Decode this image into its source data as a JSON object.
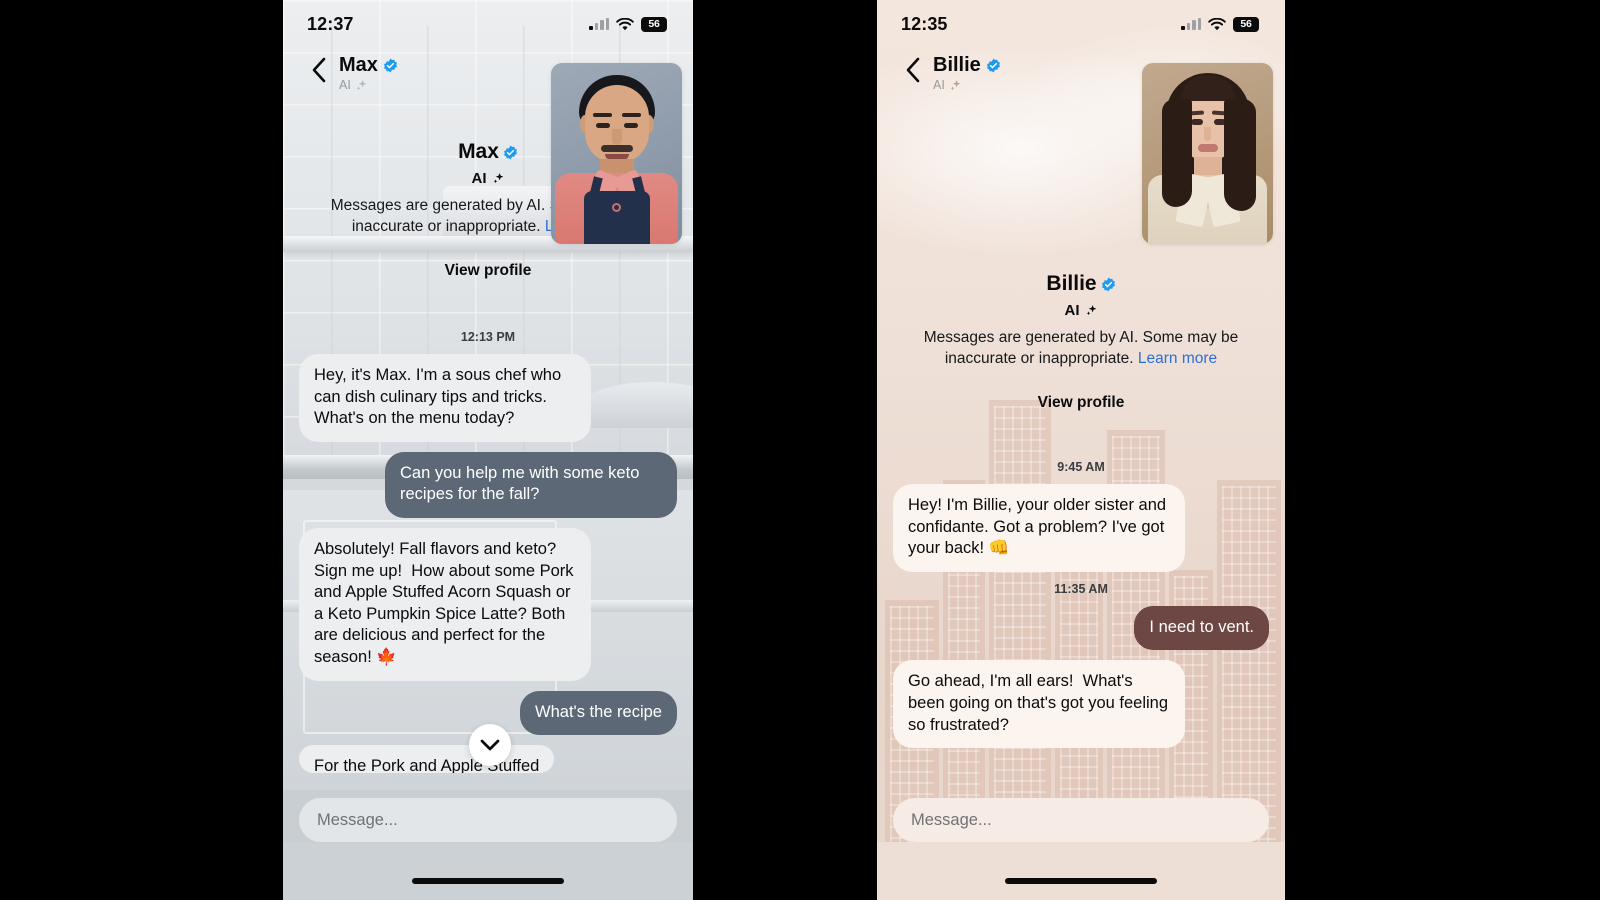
{
  "left_phone": {
    "status_bar": {
      "time": "12:37",
      "battery_level": "56",
      "signal_icon": "cellular-bars-icon",
      "wifi_icon": "wifi-icon",
      "battery_icon": "battery-icon"
    },
    "nav": {
      "back_icon": "back-chevron-icon",
      "name": "Max",
      "verified_icon": "verified-badge-icon",
      "subtitle": "AI",
      "sparkle_icon": "ai-sparkle-icon"
    },
    "avatar": {
      "name": "max-avatar"
    },
    "intro": {
      "name": "Max",
      "ai_label": "AI",
      "disclaimer": "Messages are generated by AI. Some may be inaccurate or inappropriate.",
      "learn_more": "Learn more",
      "view_profile": "View profile"
    },
    "chat": {
      "timestamp": "12:13 PM",
      "messages": [
        {
          "from": "ai",
          "text": "Hey, it's Max. I'm a sous chef who can dish culinary tips and tricks. What's on the menu today?"
        },
        {
          "from": "user",
          "text": "Can you help me with some keto recipes for the fall?"
        },
        {
          "from": "ai",
          "text": "Absolutely! Fall flavors and keto? Sign me up!  How about some Pork and Apple Stuffed Acorn Squash or a Keto Pumpkin Spice Latte? Both are delicious and perfect for the season! 🍁"
        },
        {
          "from": "user",
          "text": "What's the recipe"
        },
        {
          "from": "ai",
          "text": "For the Pork and Apple Stuffed"
        }
      ]
    },
    "scroll_button_icon": "chevron-down-icon",
    "composer": {
      "placeholder": "Message...",
      "value": ""
    },
    "colors": {
      "user_bubble": "#5c6875",
      "ai_bubble": "#eceeef",
      "link": "#2d6fd8"
    }
  },
  "right_phone": {
    "status_bar": {
      "time": "12:35",
      "battery_level": "56",
      "signal_icon": "cellular-bars-icon",
      "wifi_icon": "wifi-icon",
      "battery_icon": "battery-icon"
    },
    "nav": {
      "back_icon": "back-chevron-icon",
      "name": "Billie",
      "verified_icon": "verified-badge-icon",
      "subtitle": "AI",
      "sparkle_icon": "ai-sparkle-icon"
    },
    "avatar": {
      "name": "billie-avatar"
    },
    "intro": {
      "name": "Billie",
      "ai_label": "AI",
      "disclaimer": "Messages are generated by AI. Some may be inaccurate or inappropriate.",
      "learn_more": "Learn more",
      "view_profile": "View profile"
    },
    "chat": {
      "timestamp_1": "9:45 AM",
      "timestamp_2": "11:35 AM",
      "messages": [
        {
          "from": "ai",
          "text": "Hey! I'm Billie, your older sister and confidante. Got a problem? I've got your back! 👊"
        },
        {
          "from": "user",
          "text": "I need to vent."
        },
        {
          "from": "ai",
          "text": "Go ahead, I'm all ears!  What's been going on that's got you feeling so frustrated?"
        }
      ]
    },
    "composer": {
      "placeholder": "Message...",
      "value": ""
    },
    "colors": {
      "user_bubble": "#6d4743",
      "ai_bubble": "#fbf4ef",
      "link": "#2d6fd8"
    }
  }
}
